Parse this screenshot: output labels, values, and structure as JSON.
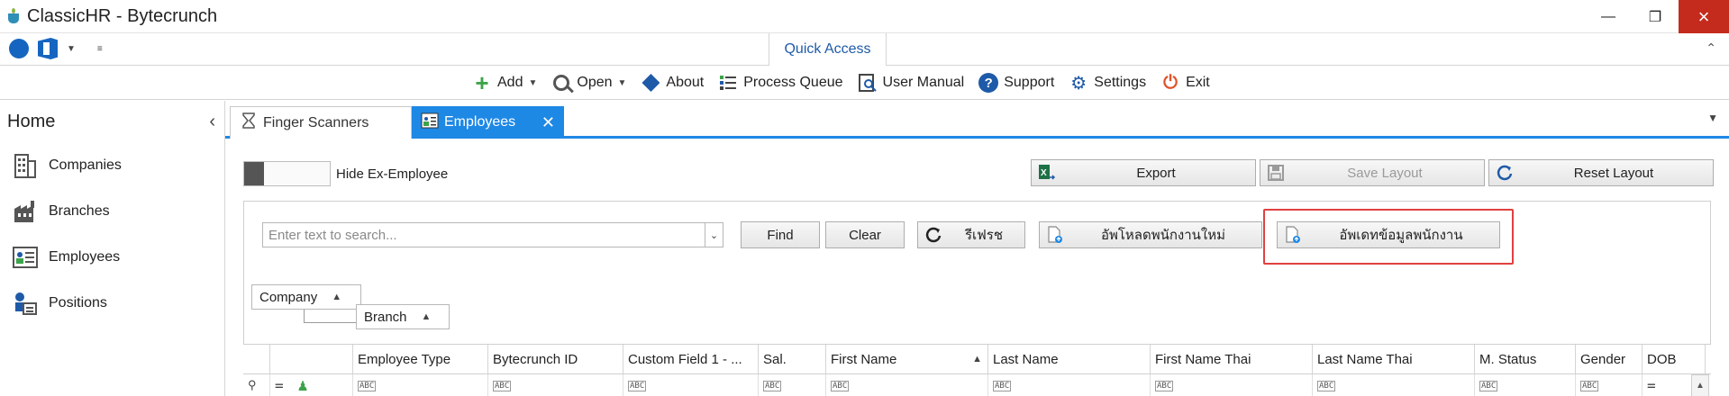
{
  "window": {
    "title": "ClassicHR - Bytecrunch"
  },
  "quick_access": {
    "tab_label": "Quick Access"
  },
  "toolbar": {
    "items": [
      {
        "label": "Add",
        "icon": "plus-icon",
        "dropdown": true
      },
      {
        "label": "Open",
        "icon": "search-icon",
        "dropdown": true
      },
      {
        "label": "About",
        "icon": "diamond-info-icon"
      },
      {
        "label": "Process Queue",
        "icon": "process-queue-icon"
      },
      {
        "label": "User Manual",
        "icon": "user-manual-icon"
      },
      {
        "label": "Support",
        "icon": "question-icon"
      },
      {
        "label": "Settings",
        "icon": "gear-icon"
      },
      {
        "label": "Exit",
        "icon": "power-icon"
      }
    ]
  },
  "sidebar": {
    "title": "Home",
    "items": [
      {
        "label": "Companies",
        "icon": "building-icon"
      },
      {
        "label": "Branches",
        "icon": "factory-icon"
      },
      {
        "label": "Employees",
        "icon": "employees-icon"
      },
      {
        "label": "Positions",
        "icon": "positions-icon"
      }
    ]
  },
  "tabs": [
    {
      "label": "Finger Scanners",
      "icon": "hourglass-icon",
      "active": false
    },
    {
      "label": "Employees",
      "icon": "employees-icon",
      "active": true
    }
  ],
  "content": {
    "hide_ex_employee_label": "Hide Ex-Employee",
    "export_label": "Export",
    "save_layout_label": "Save Layout",
    "reset_layout_label": "Reset Layout",
    "search_placeholder": "Enter text to search...",
    "find_label": "Find",
    "clear_label": "Clear",
    "refresh_label": "รีเฟรช",
    "upload_new_label": "อัพโหลดพนักงานใหม่",
    "update_data_label": "อัพเดทข้อมูลพนักงาน",
    "group_by": [
      "Company",
      "Branch"
    ]
  },
  "grid": {
    "columns": [
      {
        "label": "Employee Type",
        "sort": ""
      },
      {
        "label": "Bytecrunch ID",
        "sort": ""
      },
      {
        "label": "Custom Field 1 - ...",
        "sort": ""
      },
      {
        "label": "Sal.",
        "sort": ""
      },
      {
        "label": "First Name",
        "sort": "asc"
      },
      {
        "label": "Last Name",
        "sort": ""
      },
      {
        "label": "First Name Thai",
        "sort": ""
      },
      {
        "label": "Last Name Thai",
        "sort": ""
      },
      {
        "label": "M. Status",
        "sort": ""
      },
      {
        "label": "Gender",
        "sort": ""
      },
      {
        "label": "DOB",
        "sort": ""
      }
    ],
    "filter_glyph": "ABC"
  },
  "colors": {
    "accent": "#1e88e5",
    "close": "#c42b1c",
    "highlight": "#e04040"
  }
}
